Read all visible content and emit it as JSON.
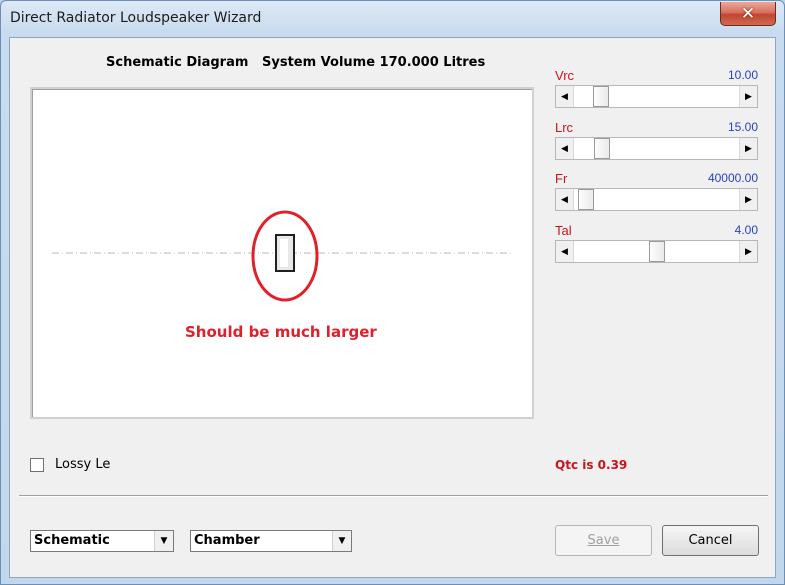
{
  "window": {
    "title": "Direct Radiator Loudspeaker Wizard",
    "close_glyph": "✕"
  },
  "header": {
    "label": "Schematic Diagram   System Volume 170.000 Litres"
  },
  "schematic": {
    "annotation": "Should be much larger"
  },
  "params": [
    {
      "name": "Vrc",
      "value": "10.00",
      "level": 0.12
    },
    {
      "name": "Lrc",
      "value": "15.00",
      "level": 0.13
    },
    {
      "name": "Fr",
      "value": "40000.00",
      "level": 0.02
    },
    {
      "name": "Tal",
      "value": "4.00",
      "level": 0.5
    }
  ],
  "lossy": {
    "label": "Lossy Le",
    "checked": false
  },
  "qtc": "Qtc is 0.39",
  "view_select": {
    "value": "Schematic"
  },
  "chamber_select": {
    "value": "Chamber"
  },
  "buttons": {
    "save": "Save",
    "cancel": "Cancel"
  },
  "icons": {
    "arrow_left": "◀",
    "arrow_right": "▶",
    "arrow_down": "▼"
  },
  "colors": {
    "param_name": "#c8141e",
    "param_value": "#2a3fc0",
    "annotation": "#e0202a"
  }
}
